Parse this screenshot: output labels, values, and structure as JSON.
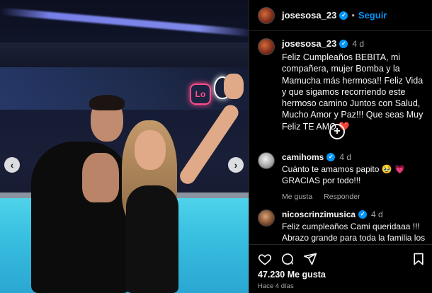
{
  "post": {
    "username": "josesosa_23",
    "follow_label": "Seguir",
    "separator": "•",
    "caption_age": "4 d",
    "caption": "Feliz Cumpleaños BEBITA, mi compañera, mujer Bomba y la Mamucha más hermosa!! Feliz Vida y que sigamos recorriendo este hermoso camino Juntos con Salud, Mucho Amor y Paz!!! Que seas Muy Feliz TE AMO",
    "caption_emoji": "❤️",
    "neon_sign_text": "Lo"
  },
  "comments": [
    {
      "username": "camihoms",
      "age": "4 d",
      "text": "Cuánto te amamos papito 🥹 💗 GRACIAS por todo!!!",
      "like_label": "Me gusta",
      "reply_label": "Responder"
    },
    {
      "username": "nicoscrinzimusica",
      "age": "4 d",
      "text": "Feliz cumpleaños Cami queridaaa !!! Abrazo grande para toda la familia los"
    }
  ],
  "carousel": {
    "prev": "‹",
    "next": "›"
  },
  "expand_label": "+",
  "likes": "47.230 Me gusta",
  "timestamp": "Hace 4 días",
  "icons": [
    "heart-icon",
    "comment-icon",
    "share-icon",
    "bookmark-icon",
    "verified-icon",
    "plus-circle-icon"
  ],
  "colors": {
    "accent": "#0095f6",
    "background": "#000000",
    "muted": "#a8a8a8",
    "heart": "#ff3040"
  }
}
